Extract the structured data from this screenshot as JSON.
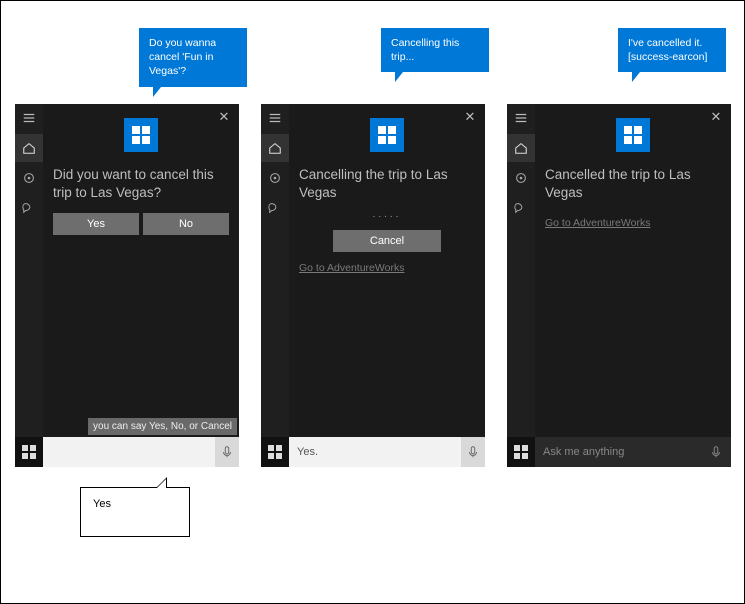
{
  "bubbles": {
    "b1": "Do you wanna cancel 'Fun in Vegas'?",
    "b2": "Cancelling this trip...",
    "b3": "I've cancelled it. [success-earcon]"
  },
  "user_reply": "Yes",
  "panels": [
    {
      "heading": "Did you want to cancel this trip to Las Vegas?",
      "yes_label": "Yes",
      "no_label": "No",
      "hint": "you can say Yes, No, or Cancel",
      "search_value": "",
      "search_placeholder": ""
    },
    {
      "heading": "Cancelling the trip to Las Vegas",
      "progress": ".....",
      "cancel_label": "Cancel",
      "link_label": "Go to AdventureWorks",
      "search_value": "Yes."
    },
    {
      "heading": "Cancelled the trip to Las Vegas",
      "link_label": "Go to AdventureWorks",
      "search_placeholder": "Ask me anything"
    }
  ],
  "icons": {
    "menu": "menu-icon",
    "home": "home-icon",
    "notebook": "notebook-icon",
    "feedback": "feedback-icon",
    "close": "✕",
    "start": "start-icon",
    "mic": "mic-icon"
  }
}
